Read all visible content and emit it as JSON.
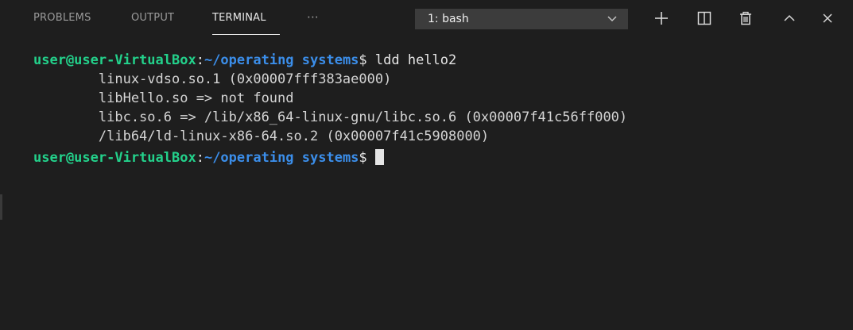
{
  "tabs": {
    "problems": "PROBLEMS",
    "output": "OUTPUT",
    "terminal": "TERMINAL",
    "more": "···"
  },
  "terminal_select": {
    "value": "1: bash"
  },
  "actions": {
    "new_terminal": "plus-icon",
    "split": "split-icon",
    "kill": "trash-icon",
    "maximize": "chevron-up-icon",
    "close": "close-icon"
  },
  "prompt": {
    "user_host": "user@user-VirtualBox",
    "colon": ":",
    "path": "~/operating systems",
    "dollar": "$"
  },
  "lines": [
    " ldd hello2",
    "        linux-vdso.so.1 (0x00007fff383ae000)",
    "        libHello.so => not found",
    "        libc.so.6 => /lib/x86_64-linux-gnu/libc.so.6 (0x00007f41c56ff000)",
    "        /lib64/ld-linux-x86-64.so.2 (0x00007f41c5908000)"
  ],
  "colors": {
    "background": "#1e1e1e",
    "prompt_user": "#23d18b",
    "prompt_path": "#3b8eea",
    "text": "#e5e5e5"
  }
}
